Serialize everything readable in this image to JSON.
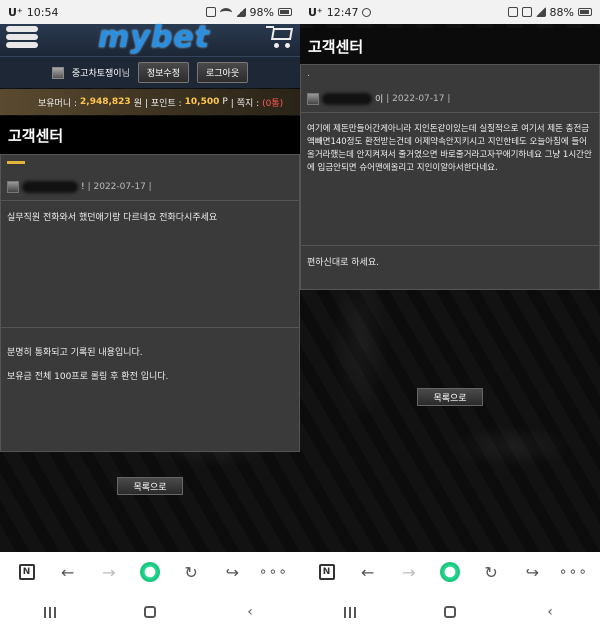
{
  "left": {
    "status": {
      "carrier": "U⁺",
      "time": "10:54",
      "battery": "98%"
    },
    "site": {
      "logo": "mybet"
    },
    "user": {
      "name": "중고차토쟁이",
      "suffix": "님",
      "info_btn": "정보수정",
      "logout_btn": "로그아웃"
    },
    "money": {
      "balance_label": "보유머니 :",
      "balance": "2,948,823",
      "balance_unit": "원",
      "point_label": "| 포인트 :",
      "point": "10,500",
      "point_unit": "P",
      "note_label": "| 쪽지 :",
      "note": "(0통)"
    },
    "title": "고객센터",
    "post": {
      "author_suffix": "!",
      "meta": "| 2022-07-17 |",
      "body": "실무직원 전화와서 했던애기랑 다르네요 전화다시주세요"
    },
    "reply": {
      "line1": "분명히 통화되고 기록된 내용입니다.",
      "line2": "보유금 전체 100프로 롤링 후 환전 입니다."
    },
    "list_btn": "목록으로"
  },
  "right": {
    "status": {
      "carrier": "U⁺",
      "time": "12:47",
      "battery": "88%"
    },
    "title": "고객센터",
    "post": {
      "mark": ".",
      "author_suffix": "이",
      "meta": "| 2022-07-17 |",
      "body": "여기에 제돈만들어간게아니라 지인돈같이있는데 실질적으로 여기서 제돈 충전금액빼면140정도 환전받는건데 어제약속안지키시고 지인한테도 오늘아침에 들어올거라했는데 안지켜져서 줄거였으면 바로줄거라고자꾸애기하네요 그냥 1시간안에 입금안되면 슈어맨에올리고 지인이알아서한다네요."
    },
    "reply": {
      "line1": "편하신대로 하세요."
    },
    "list_btn": "목록으로"
  }
}
